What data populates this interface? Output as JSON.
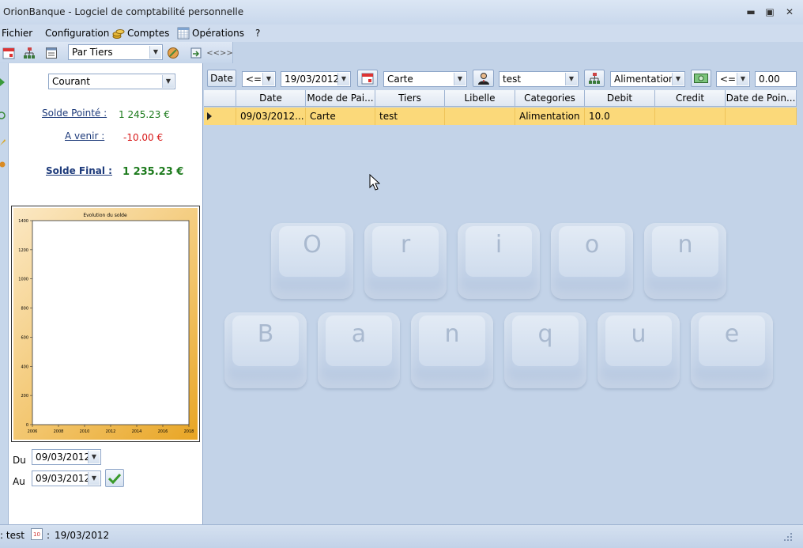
{
  "window": {
    "title": "OrionBanque - Logciel de comptabilité personnelle",
    "minimize": "▬",
    "maximize": "▣",
    "close": "✕"
  },
  "menu": {
    "file": "Fichier",
    "configuration": "Configuration",
    "accounts": "Comptes",
    "operations": "Opérations",
    "help": "?"
  },
  "toolbar": {
    "grouping": "Par Tiers",
    "expand_label": "<<>>"
  },
  "left": {
    "account": "Courant",
    "solde_pointe_label": "Solde Pointé :",
    "solde_pointe_value": "1 245.23 €",
    "a_venir_label": "A venir :",
    "a_venir_value": "-10.00 €",
    "solde_final_label": "Solde Final :",
    "solde_final_value": "1 235.23 €",
    "du_label": "Du",
    "du_value": "09/03/2012",
    "au_label": "Au",
    "au_value": "09/03/2012"
  },
  "chart_data": {
    "type": "line",
    "title": "Evolution du solde",
    "xlabel": "",
    "ylabel": "",
    "x_ticks": [
      "2006",
      "2008",
      "2010",
      "2012",
      "2014",
      "2016",
      "2018"
    ],
    "y_ticks": [
      "0",
      "200",
      "400",
      "600",
      "800",
      "1000",
      "1200",
      "1400"
    ],
    "ylim": [
      0,
      1400
    ],
    "series": []
  },
  "filters": {
    "date_button": "Date",
    "date_operator": "<=",
    "date_value": "19/03/2012",
    "mode_value": "Carte",
    "tiers_value": "test",
    "category_value": "Alimentation",
    "amount_operator": "<=",
    "amount_value": "0.00"
  },
  "grid": {
    "columns": [
      "Date",
      "Mode de Pai...",
      "Tiers",
      "Libelle",
      "Categories",
      "Debit",
      "Credit",
      "Date de Poin..."
    ],
    "rows": [
      {
        "date": "09/03/2012...",
        "mode": "Carte",
        "tiers": "test",
        "libelle": "",
        "categorie": "Alimentation",
        "debit": "10.0",
        "credit": "",
        "date_pointage": ""
      }
    ]
  },
  "watermark": {
    "row1": [
      "O",
      "r",
      "i",
      "o",
      "n"
    ],
    "row2": [
      "B",
      "a",
      "n",
      "q",
      "u",
      "e"
    ]
  },
  "status": {
    "user_prefix": ": test",
    "date_prefix": ":",
    "date": "19/03/2012",
    "calendar_icon_text": "10"
  },
  "colors": {
    "selected_row": "#fbd97a",
    "positive": "#1c7a1c",
    "negative": "#d81b1b",
    "background": "#c3d3e8"
  }
}
